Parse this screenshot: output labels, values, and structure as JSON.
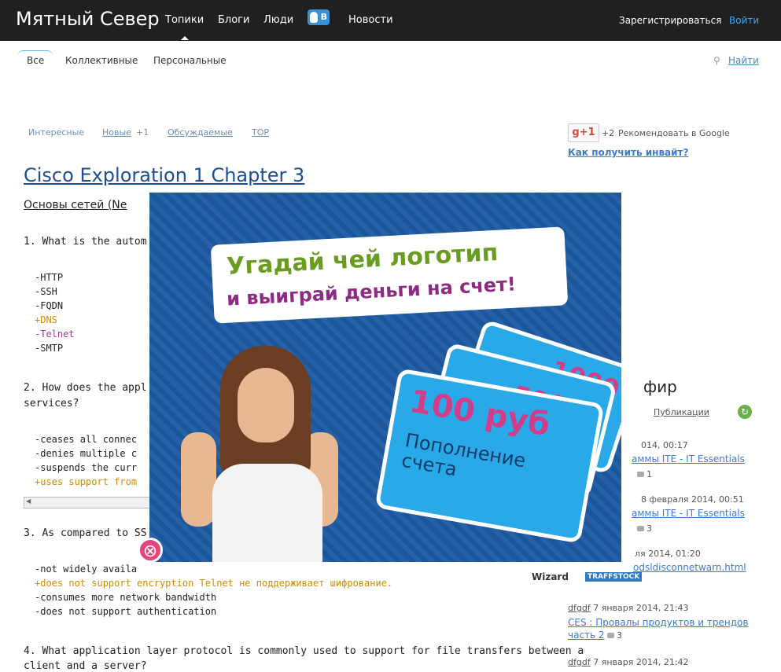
{
  "header": {
    "logo": "Мятный Север",
    "nav": [
      "Топики",
      "Блоги",
      "Люди",
      "Новости"
    ],
    "vk_badge": "B",
    "register": "Зарегистрироваться",
    "login": "Войти"
  },
  "subnav": [
    "Все",
    "Коллективные",
    "Персональные"
  ],
  "search_link": "Найти",
  "filters": {
    "interesting": "Интересные",
    "new": "Новые",
    "new_count": "+1",
    "discussed": "Обсуждаемые",
    "top": "TOP"
  },
  "google": {
    "button": "g+1",
    "count": "+2",
    "recommend": "Рекомендовать в Google"
  },
  "invite_link": "Как получить инвайт?",
  "article": {
    "title": "Cisco Exploration 1 Chapter 3",
    "subtitle": "Основы сетей (Ne",
    "q1": "1. What is the autom",
    "q1_options": [
      "-HTTP",
      "-SSH",
      "-FQDN",
      "+DNS",
      "-Telnet",
      "-SMTP"
    ],
    "q2_line1": "2. How does the appl",
    "q2_line2": "services?",
    "q2_options": [
      "-ceases all connec",
      "-denies multiple c",
      "-suspends the curr",
      "+uses support from"
    ],
    "q3": "3. As compared to SS",
    "q3_options": [
      "-not widely availa",
      "+does not support encryption Telnet не поддерживает шифрование.",
      "-consumes more network bandwidth",
      "-does not support authentication"
    ],
    "q4_line1": "4. What application layer protocol is commonly used to support for file transfers between a",
    "q4_line2": "client and a server?"
  },
  "sidebar": {
    "heading": "фир",
    "tab_publications": "Публикации",
    "entries": [
      {
        "meta": "014, 00:17",
        "link": "аммы ITE - IT Essentials",
        "count": "1"
      },
      {
        "meta": "8 февраля 2014, 00:51",
        "link": "аммы ITE - IT Essentials",
        "count": "3"
      },
      {
        "meta": "ля 2014, 01:20",
        "link": "odsldisconnetwarn.html",
        "count": ""
      },
      {
        "user": "dfgdf",
        "meta": "7 января 2014, 21:43",
        "link": "CES : Провалы продуктов и трендов часть 2",
        "count": "3"
      },
      {
        "user": "dfgdf",
        "meta": "7 января 2014, 21:42",
        "link": "",
        "count": ""
      }
    ]
  },
  "ad": {
    "line1": "Угадай чей логотип",
    "line2": "и выиграй деньги на счет!",
    "card_back1": "1000",
    "card_back2": "500",
    "card_value": "100 руб",
    "card_text1": "Пополнение",
    "card_text2": "счета",
    "close": "⊗",
    "brand_wizard": "Wizard",
    "brand_traffstock": "TRAFFSTOCK"
  },
  "colors": {
    "topbar": "#202020",
    "link": "#3d7cc9",
    "ad_bg": "#1d5aa3",
    "card": "#2aa9e8",
    "ad_green": "#6a9c1f",
    "ad_purple": "#8d2a83",
    "close": "#e5457b"
  }
}
